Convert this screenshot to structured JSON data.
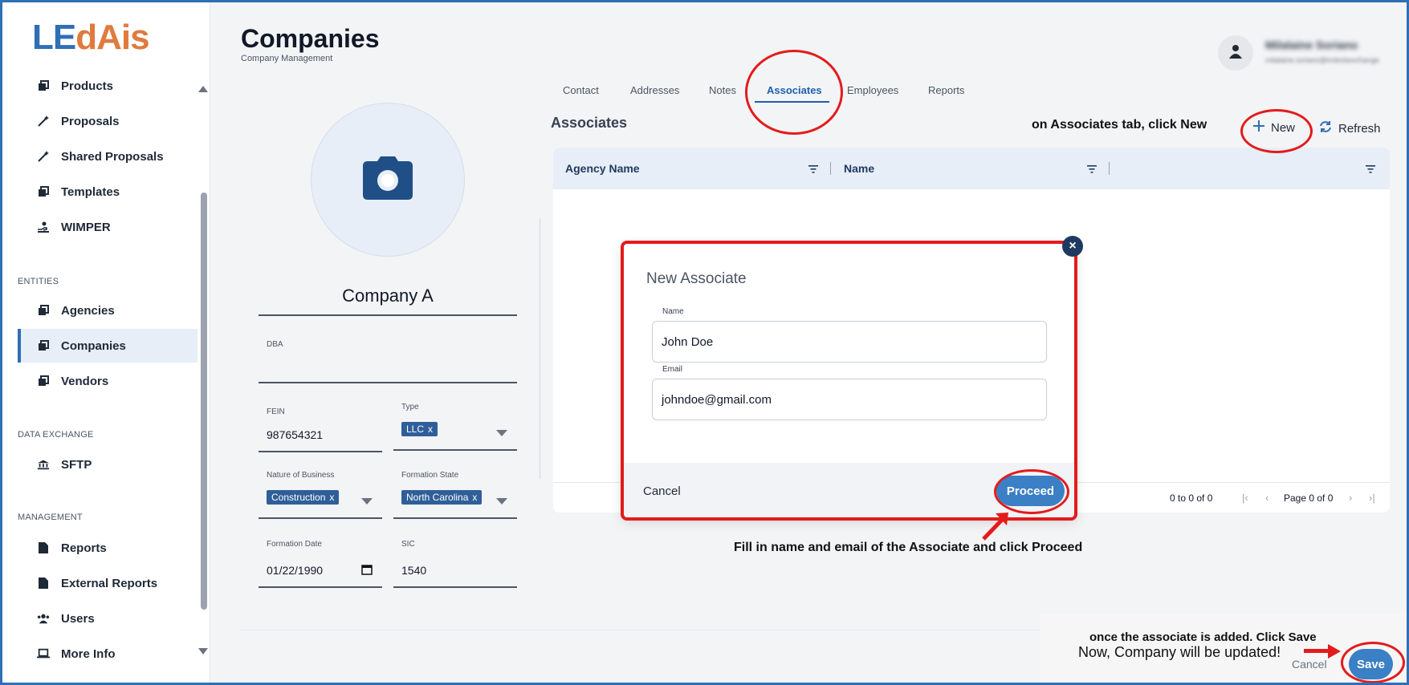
{
  "brand": {
    "logo_part1": "LE",
    "logo_part2": "dAis"
  },
  "sidebar": {
    "items_top": [
      {
        "label": "Products",
        "icon": "stack-icon"
      },
      {
        "label": "Proposals",
        "icon": "magic-wand-icon"
      },
      {
        "label": "Shared Proposals",
        "icon": "magic-wand-icon"
      },
      {
        "label": "Templates",
        "icon": "stack-icon"
      },
      {
        "label": "WIMPER",
        "icon": "hand-coin-icon"
      }
    ],
    "entities_title": "ENTITIES",
    "entities": [
      {
        "label": "Agencies"
      },
      {
        "label": "Companies",
        "active": true
      },
      {
        "label": "Vendors"
      }
    ],
    "data_exchange_title": "DATA EXCHANGE",
    "data_exchange": [
      {
        "label": "SFTP"
      }
    ],
    "management_title": "MANAGEMENT",
    "management": [
      {
        "label": "Reports"
      },
      {
        "label": "External Reports"
      },
      {
        "label": "Users"
      },
      {
        "label": "More Info"
      }
    ]
  },
  "header": {
    "title": "Companies",
    "subtitle": "Company Management",
    "user_name": "Milalaine Soriano",
    "user_email": "milalaine.soriano@imteckexchange"
  },
  "company": {
    "name": "Company A",
    "dba_label": "DBA",
    "dba_value": "",
    "fein_label": "FEIN",
    "fein_value": "987654321",
    "type_label": "Type",
    "type_chip": "LLC",
    "nature_label": "Nature of Business",
    "nature_chip": "Construction",
    "state_label": "Formation State",
    "state_chip": "North Carolina",
    "chip_remove": "x",
    "date_label": "Formation Date",
    "date_value": "01/22/1990",
    "sic_label": "SIC",
    "sic_value": "1540"
  },
  "tabs": [
    "Contact",
    "Addresses",
    "Notes",
    "Associates",
    "Employees",
    "Reports"
  ],
  "active_tab": "Associates",
  "associates": {
    "heading": "Associates",
    "new_label": "New",
    "refresh_label": "Refresh",
    "columns": [
      "Agency Name",
      "Name",
      ""
    ],
    "count_text": "0 to 0 of 0",
    "page_text": "Page 0 of 0"
  },
  "modal": {
    "title": "New Associate",
    "name_label": "Name",
    "name_value": "John Doe",
    "email_label": "Email",
    "email_value": "johndoe@gmail.com",
    "cancel_label": "Cancel",
    "proceed_label": "Proceed"
  },
  "footer": {
    "cancel_label": "Cancel",
    "save_label": "Save"
  },
  "annotations": {
    "new_note": "on Associates tab, click New",
    "proceed_note": "Fill in name and email of the Associate and click Proceed",
    "save_note1": "once the associate is added. Click Save",
    "save_note2": "Now, Company will be updated!"
  },
  "colors": {
    "accent": "#2f6fb5",
    "logo_orange": "#e07a3e",
    "annotation_red": "#e31b1b",
    "button_blue": "#3b7fc4"
  }
}
